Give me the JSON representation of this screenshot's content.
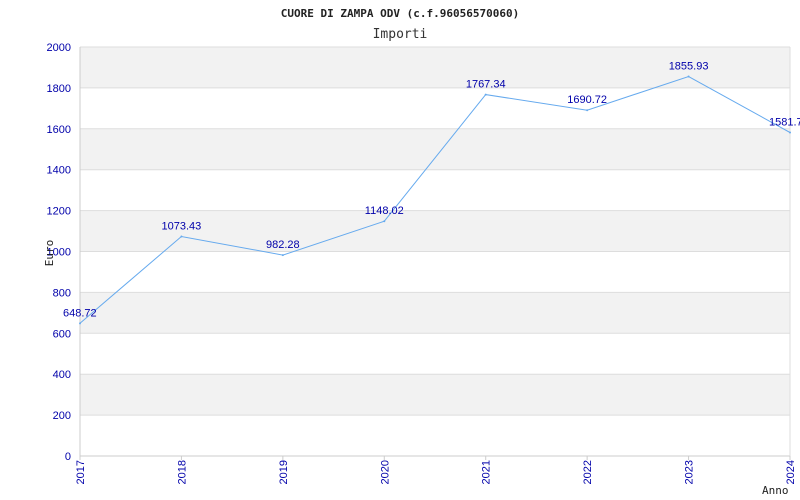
{
  "chart_data": {
    "type": "line",
    "title": "CUORE DI ZAMPA ODV (c.f.96056570060)",
    "subtitle": "Importi",
    "xlabel": "Anno",
    "ylabel": "Euro",
    "categories": [
      "2017",
      "2018",
      "2019",
      "2020",
      "2021",
      "2022",
      "2023",
      "2024"
    ],
    "series": [
      {
        "values": [
          648.72,
          1073.43,
          982.28,
          1148.02,
          1767.34,
          1690.72,
          1855.93,
          1581.7
        ]
      }
    ],
    "ylim": [
      0,
      2000
    ],
    "yticks": [
      0,
      200,
      400,
      600,
      800,
      1000,
      1200,
      1400,
      1600,
      1800,
      2000
    ],
    "data_labels": [
      "648.72",
      "1073.43",
      "982.28",
      "1148.02",
      "1767.34",
      "1690.72",
      "1855.93",
      "1581.7"
    ],
    "grid": true,
    "alternating_bands": true,
    "colors": {
      "line": "#66aaee",
      "band": "#f2f2f2",
      "grid": "#dddddd",
      "axis": "#cccccc",
      "ticks": "#0000aa"
    }
  }
}
